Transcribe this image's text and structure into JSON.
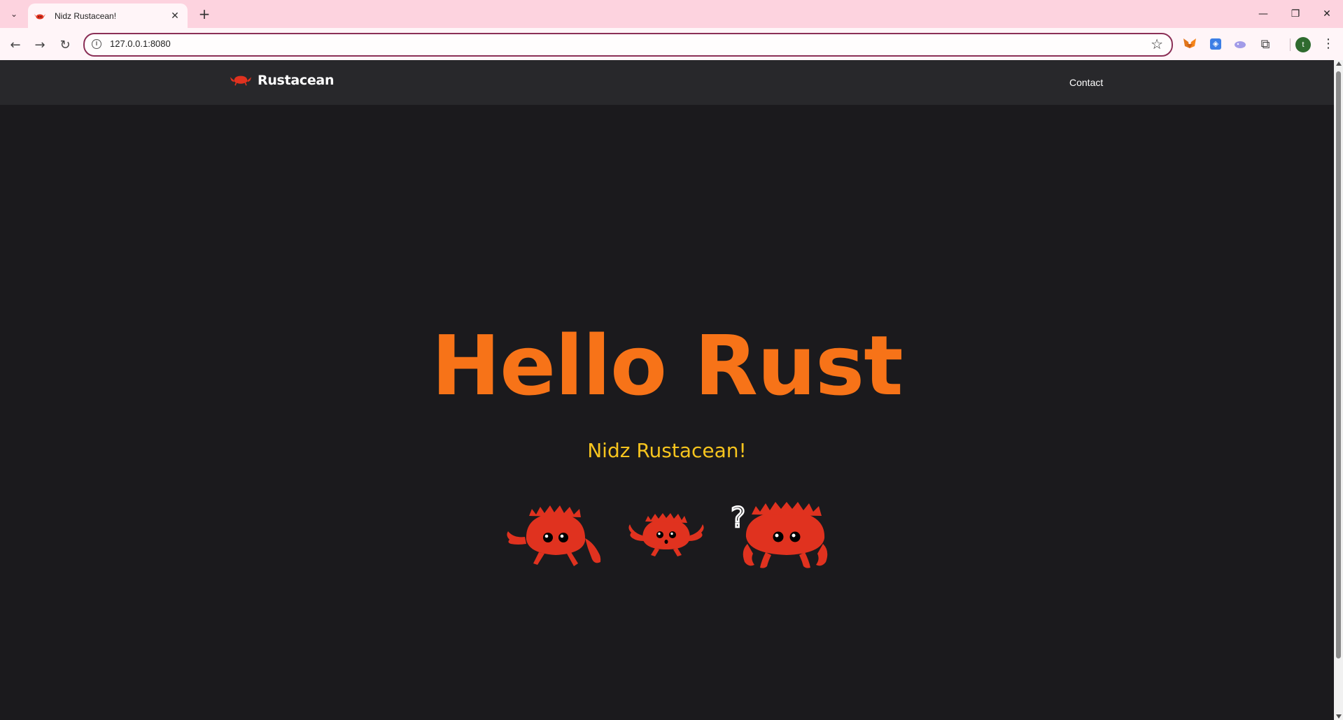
{
  "browser": {
    "tab": {
      "title": "Nidz Rustacean!"
    },
    "new_tab_label": "+",
    "url": "127.0.0.1:8080",
    "profile_initial": "t",
    "window_controls": {
      "minimize": "—",
      "restore": "❐",
      "close": "✕"
    }
  },
  "site": {
    "brand": "Rustacean",
    "nav": {
      "contact": "Contact"
    },
    "hero": {
      "title": "Hello Rust",
      "subtitle": "Nidz Rustacean!"
    },
    "crab_question_mark": "?"
  },
  "colors": {
    "title": "#f77318",
    "subtitle": "#f6c41e",
    "crab": "#e0321f",
    "page_bg": "#1b1a1d",
    "header_bg": "#28282b",
    "tabstrip_bg": "#fdd3df"
  },
  "icons": {
    "tab_search": "chevron-down-icon",
    "back": "arrow-left-icon",
    "forward": "arrow-right-icon",
    "reload": "reload-icon",
    "site_info": "info-icon",
    "bookmark": "star-icon",
    "extensions": "puzzle-icon",
    "menu": "kebab-menu-icon"
  }
}
